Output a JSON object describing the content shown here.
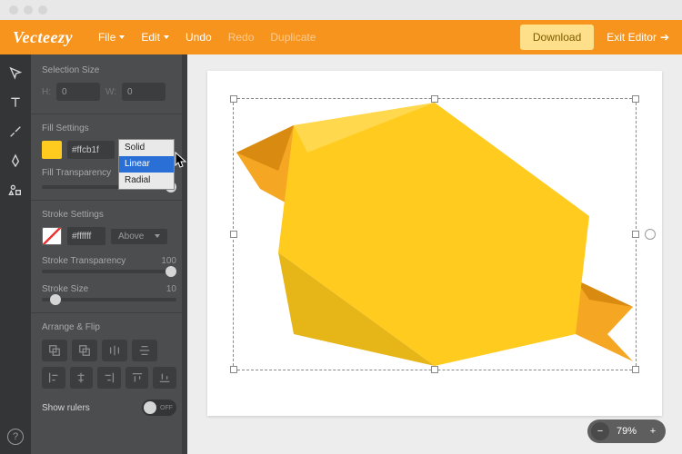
{
  "brand": "Vecteezy",
  "menu": {
    "file": "File",
    "edit": "Edit",
    "undo": "Undo",
    "redo": "Redo",
    "duplicate": "Duplicate"
  },
  "actions": {
    "download": "Download",
    "exit": "Exit Editor"
  },
  "sidebar": {
    "selection_size_label": "Selection Size",
    "h_label": "H:",
    "w_label": "W:",
    "h_value": "0",
    "w_value": "0",
    "fill_settings_label": "Fill Settings",
    "fill_hex": "#ffcb1f",
    "fill_type_options": {
      "solid": "Solid",
      "linear": "Linear",
      "radial": "Radial"
    },
    "fill_transparency_label": "Fill Transparency",
    "stroke_settings_label": "Stroke Settings",
    "stroke_hex": "#ffffff",
    "stroke_position": "Above",
    "stroke_transparency_label": "Stroke Transparency",
    "stroke_transparency_value": "100",
    "stroke_size_label": "Stroke Size",
    "stroke_size_value": "10",
    "arrange_label": "Arrange & Flip",
    "show_rulers_label": "Show rulers",
    "toggle_off": "OFF"
  },
  "zoom": {
    "level": "79%"
  },
  "help_glyph": "?"
}
